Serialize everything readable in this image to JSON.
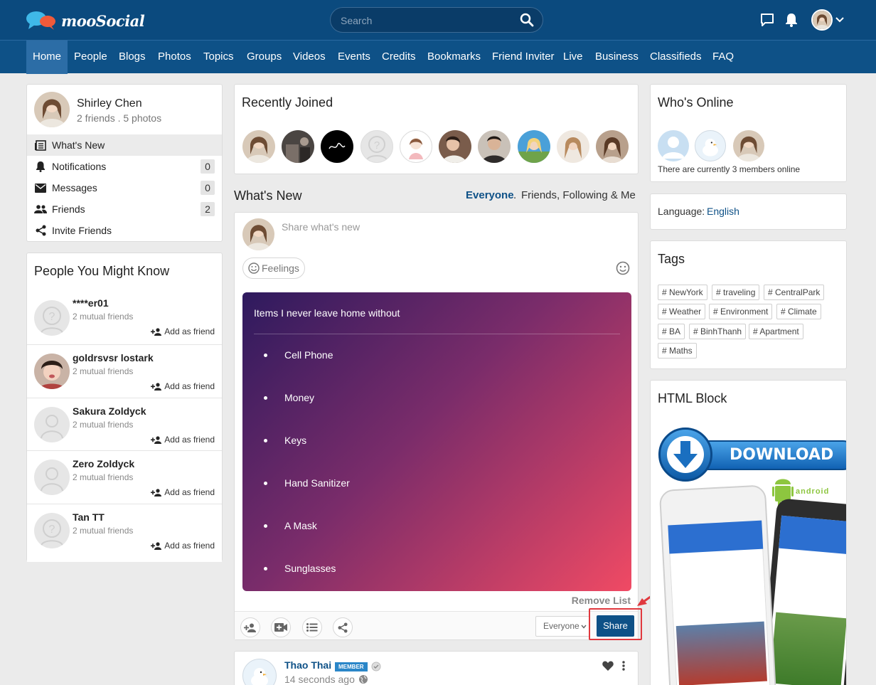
{
  "app": {
    "name": "mooSocial"
  },
  "search": {
    "placeholder": "Search"
  },
  "nav": [
    "Home",
    "People",
    "Blogs",
    "Photos",
    "Topics",
    "Groups",
    "Videos",
    "Events",
    "Credits",
    "Bookmarks",
    "Friend Inviter",
    "Live",
    "Business",
    "Classifieds",
    "FAQ"
  ],
  "profile": {
    "name": "Shirley Chen",
    "meta": "2 friends . 5 photos",
    "menu": [
      {
        "label": "What's New",
        "icon": "newspaper-icon",
        "count": null
      },
      {
        "label": "Notifications",
        "icon": "bell-icon",
        "count": "0"
      },
      {
        "label": "Messages",
        "icon": "envelope-icon",
        "count": "0"
      },
      {
        "label": "Friends",
        "icon": "people-icon",
        "count": "2"
      },
      {
        "label": "Invite Friends",
        "icon": "share-icon",
        "count": null
      }
    ]
  },
  "pymk": {
    "title": "People You Might Know",
    "add_label": "Add as friend",
    "people": [
      {
        "name": "****er01",
        "mutual": "2 mutual friends"
      },
      {
        "name": "goldrsvsr lostark",
        "mutual": "2 mutual friends"
      },
      {
        "name": "Sakura Zoldyck",
        "mutual": "2 mutual friends"
      },
      {
        "name": "Zero Zoldyck",
        "mutual": "2 mutual friends"
      },
      {
        "name": "Tan TT",
        "mutual": "2 mutual friends"
      }
    ]
  },
  "recently_joined": {
    "title": "Recently Joined"
  },
  "whats_new": {
    "title": "What's New",
    "filter_everyone": "Everyone",
    "filter_sep": ".",
    "filter_friends": "Friends, Following & Me"
  },
  "composer": {
    "placeholder": "Share what's new",
    "feelings": "Feelings",
    "list_title": "Items I never leave home without",
    "items": [
      "Cell Phone",
      "Money",
      "Keys",
      "Hand Sanitizer",
      "A Mask",
      "Sunglasses"
    ],
    "remove_list": "Remove List",
    "privacy": "Everyone",
    "share": "Share"
  },
  "post": {
    "author": "Thao Thai",
    "badge": "MEMBER",
    "time": "14 seconds ago"
  },
  "online": {
    "title": "Who's Online",
    "text": "There are currently 3 members online"
  },
  "language": {
    "label": "Language:",
    "value": "English"
  },
  "tags": {
    "title": "Tags",
    "items": [
      "# NewYork",
      "# traveling",
      "# CentralPark",
      "# Weather",
      "# Environment",
      "# Climate",
      "# BA",
      "# BinhThanh",
      "# Apartment",
      "# Maths"
    ]
  },
  "html_block": {
    "title": "HTML Block",
    "download": "DOWNLOAD",
    "android": "android"
  },
  "colors": {
    "header": "#0b4a7e",
    "nav": "#0e5187",
    "accent": "#0e5187",
    "gradient_start": "#2e1a5e",
    "gradient_end": "#f04a64",
    "highlight": "#e0383e"
  }
}
